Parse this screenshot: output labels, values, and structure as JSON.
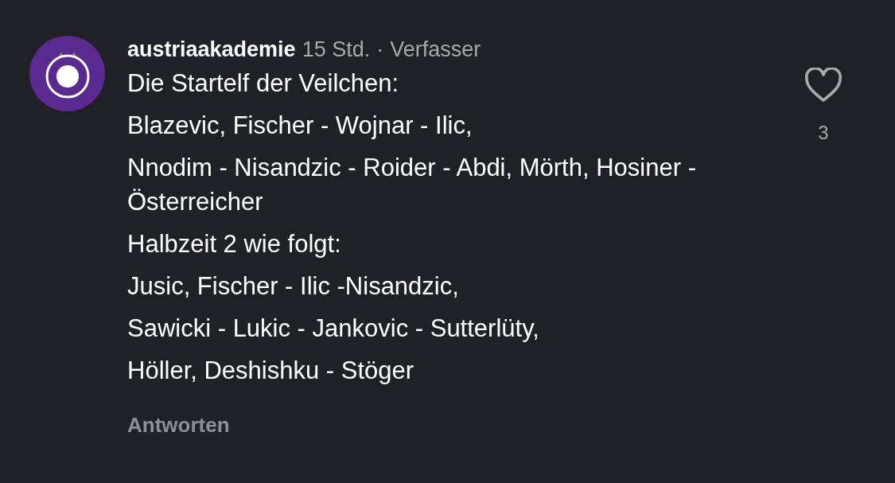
{
  "comment": {
    "username": "austriaakademie",
    "time": "15 Std.",
    "separator": "·",
    "author_label": "Verfasser",
    "paragraphs": [
      "Die Startelf der Veilchen:",
      "Blazevic, Fischer - Wojnar - Ilic,",
      "Nnodim - Nisandzic - Roider - Abdi, Mörth, Hosiner - Österreicher",
      "Halbzeit 2 wie folgt:",
      "Jusic, Fischer - Ilic -Nisandzic,",
      "Sawicki - Lukic - Jankovic - Sutterlüty,",
      "Höller, Deshishku - Stöger"
    ],
    "reply_label": "Antworten",
    "liked": false,
    "like_count": "3"
  }
}
